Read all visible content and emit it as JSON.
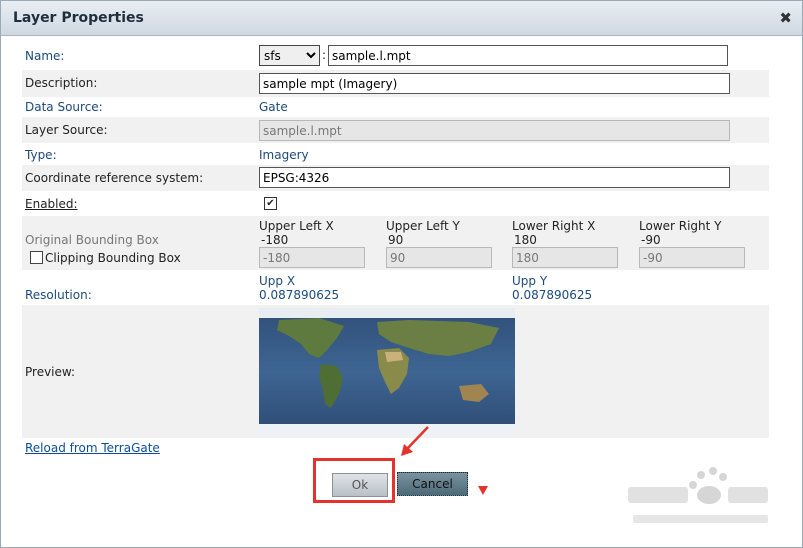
{
  "dialog": {
    "title": "Layer Properties"
  },
  "name": {
    "label": "Name:",
    "prefix": "sfs",
    "value": "sample.l.mpt"
  },
  "description": {
    "label": "Description:",
    "value": "sample mpt (Imagery)"
  },
  "data_source": {
    "label": "Data Source:",
    "value": "Gate"
  },
  "layer_source": {
    "label": "Layer Source:",
    "value": "sample.l.mpt"
  },
  "type": {
    "label": "Type:",
    "value": "Imagery"
  },
  "crs": {
    "label": "Coordinate reference system:",
    "value": "EPSG:4326"
  },
  "enabled": {
    "label": "Enabled:",
    "checked": true,
    "mark": "✔"
  },
  "bbox": {
    "label": "Original Bounding Box",
    "clipping_label": "Clipping Bounding Box",
    "clipping_checked": false,
    "ulx": {
      "header": "Upper Left X",
      "original": "-180",
      "input": "-180"
    },
    "uly": {
      "header": "Upper Left Y",
      "original": "90",
      "input": "90"
    },
    "lrx": {
      "header": "Lower Right X",
      "original": "180",
      "input": "180"
    },
    "lry": {
      "header": "Lower Right Y",
      "original": "-90",
      "input": "-90"
    }
  },
  "resolution": {
    "label": "Resolution:",
    "upp_x": {
      "header": "Upp X",
      "value": "0.087890625"
    },
    "upp_y": {
      "header": "Upp Y",
      "value": "0.087890625"
    }
  },
  "preview": {
    "label": "Preview:"
  },
  "reload_link": "Reload from TerraGate",
  "buttons": {
    "ok": "Ok",
    "cancel": "Cancel"
  },
  "colors": {
    "accent_red": "#e4332d",
    "label_blue": "#1c4a7a",
    "link_blue": "#0b4d9c"
  }
}
